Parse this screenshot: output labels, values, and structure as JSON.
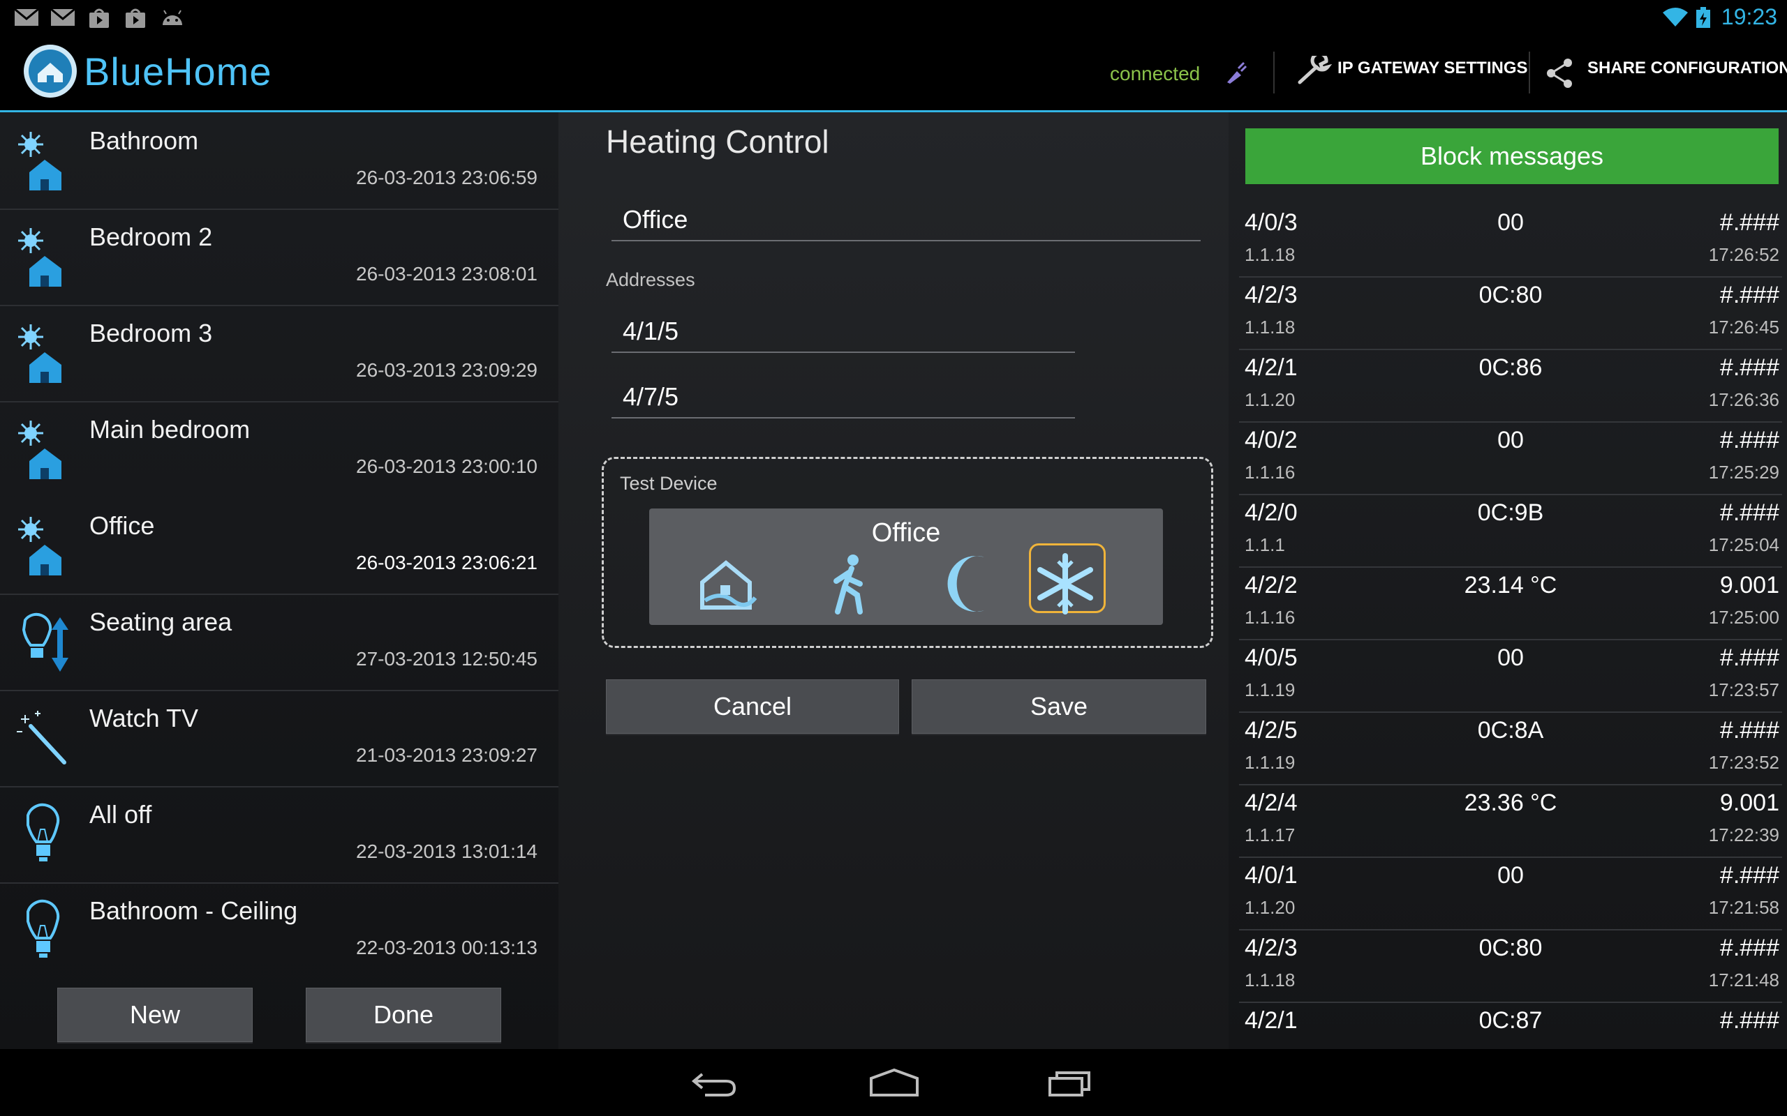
{
  "status_bar": {
    "time": "19:23",
    "left_icons": [
      "gmail-icon",
      "gmail-icon",
      "play-store-icon",
      "play-store-icon",
      "android-icon"
    ],
    "right_icons": [
      "wifi-icon",
      "battery-icon"
    ]
  },
  "action_bar": {
    "app_title": "BlueHome",
    "connection_status": "connected",
    "gateway_settings_label": "IP GATEWAY SETTINGS",
    "share_config_label": "SHARE CONFIGURATION",
    "accent_color": "#33b5e5",
    "status_color": "#8bc34a"
  },
  "scenes": [
    {
      "name": "Bathroom",
      "time": "26-03-2013 23:06:59",
      "icon": "heating-house-icon"
    },
    {
      "name": "Bedroom 2",
      "time": "26-03-2013 23:08:01",
      "icon": "heating-house-icon"
    },
    {
      "name": "Bedroom 3",
      "time": "26-03-2013 23:09:29",
      "icon": "heating-house-icon"
    },
    {
      "name": "Main bedroom",
      "time": "26-03-2013 23:00:10",
      "icon": "heating-house-icon"
    },
    {
      "name": "Office",
      "time": "26-03-2013 23:06:21",
      "icon": "heating-house-icon"
    },
    {
      "name": "Seating area",
      "time": "27-03-2013 12:50:45",
      "icon": "dimmer-bulb-icon"
    },
    {
      "name": "Watch TV",
      "time": "21-03-2013 23:09:27",
      "icon": "magic-wand-icon"
    },
    {
      "name": "All off",
      "time": "22-03-2013 13:01:14",
      "icon": "bulb-icon"
    },
    {
      "name": "Bathroom - Ceiling",
      "time": "22-03-2013 00:13:13",
      "icon": "bulb-icon"
    }
  ],
  "left_buttons": {
    "new_label": "New",
    "done_label": "Done"
  },
  "heating_control": {
    "title": "Heating Control",
    "name_value": "Office",
    "addresses_label": "Addresses",
    "address_1": "4/1/5",
    "address_2": "4/7/5",
    "test_device_label": "Test Device",
    "device_name": "Office",
    "modes": [
      "comfort-house-icon",
      "standby-walking-icon",
      "night-moon-icon",
      "frost-snowflake-icon"
    ],
    "selected_mode": "frost-snowflake-icon",
    "selected_color": "#f0b43a",
    "cancel_label": "Cancel",
    "save_label": "Save"
  },
  "message_log": {
    "block_label": "Block messages",
    "block_color": "#3aa53a",
    "rows": [
      {
        "addr": "4/0/3",
        "src": "1.1.18",
        "value": "00",
        "decoded": "#.###",
        "time": "17:26:52"
      },
      {
        "addr": "4/2/3",
        "src": "1.1.18",
        "value": "0C:80",
        "decoded": "#.###",
        "time": "17:26:45"
      },
      {
        "addr": "4/2/1",
        "src": "1.1.20",
        "value": "0C:86",
        "decoded": "#.###",
        "time": "17:26:36"
      },
      {
        "addr": "4/0/2",
        "src": "1.1.16",
        "value": "00",
        "decoded": "#.###",
        "time": "17:25:29"
      },
      {
        "addr": "4/2/0",
        "src": "1.1.1",
        "value": "0C:9B",
        "decoded": "#.###",
        "time": "17:25:04"
      },
      {
        "addr": "4/2/2",
        "src": "1.1.16",
        "value": "23.14 °C",
        "decoded": "9.001",
        "time": "17:25:00"
      },
      {
        "addr": "4/0/5",
        "src": "1.1.19",
        "value": "00",
        "decoded": "#.###",
        "time": "17:23:57"
      },
      {
        "addr": "4/2/5",
        "src": "1.1.19",
        "value": "0C:8A",
        "decoded": "#.###",
        "time": "17:23:52"
      },
      {
        "addr": "4/2/4",
        "src": "1.1.17",
        "value": "23.36 °C",
        "decoded": "9.001",
        "time": "17:22:39"
      },
      {
        "addr": "4/0/1",
        "src": "1.1.20",
        "value": "00",
        "decoded": "#.###",
        "time": "17:21:58"
      },
      {
        "addr": "4/2/3",
        "src": "1.1.18",
        "value": "0C:80",
        "decoded": "#.###",
        "time": "17:21:48"
      },
      {
        "addr": "4/2/1",
        "src": "",
        "value": "0C:87",
        "decoded": "#.###",
        "time": ""
      }
    ]
  },
  "nav_bar": {
    "icons": [
      "back-icon",
      "home-icon",
      "recent-apps-icon"
    ]
  }
}
